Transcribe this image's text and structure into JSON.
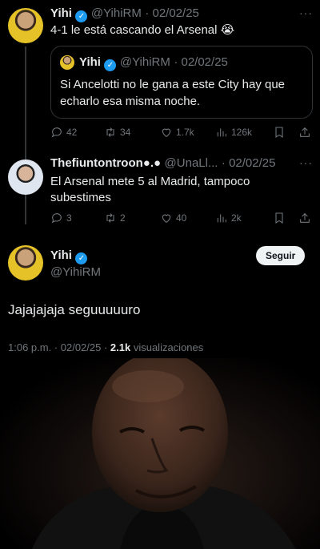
{
  "tweet1": {
    "name": "Yihi",
    "handle": "@YihiRM",
    "date": "· 02/02/25",
    "text": "4-1 le está cascando el Arsenal 😭",
    "stats": {
      "replies": "42",
      "retweets": "34",
      "likes": "1.7k",
      "views": "126k"
    }
  },
  "quoted": {
    "name": "Yihi",
    "handle": "@YihiRM",
    "date": "· 02/02/25",
    "text": "Si Ancelotti no le gana a este City hay que echarlo esa misma noche."
  },
  "tweet2": {
    "name": "Thefiuntontroon●.●",
    "handle": "@UnaLl...",
    "date": "· 02/02/25",
    "text": "El Arsenal mete 5 al Madrid, tampoco subestimes",
    "stats": {
      "replies": "3",
      "retweets": "2",
      "likes": "40",
      "views": "2k"
    }
  },
  "main": {
    "name": "Yihi",
    "handle": "@YihiRM",
    "follow_label": "Seguir",
    "text": "Jajajajaja seguuuuuro",
    "time": "1:06 p.m. · 02/02/25 · ",
    "views_count": "2.1k",
    "views_label": " visualizaciones"
  },
  "icons": {
    "more": "more-dots-icon",
    "verified": "verified-badge-icon",
    "reply": "reply-icon",
    "retweet": "retweet-icon",
    "like": "heart-icon",
    "views": "views-bar-icon",
    "bookmark": "bookmark-icon",
    "share": "share-icon"
  },
  "colors": {
    "verified": "#1d9bf0",
    "muted": "#71767b",
    "background": "#000000"
  }
}
